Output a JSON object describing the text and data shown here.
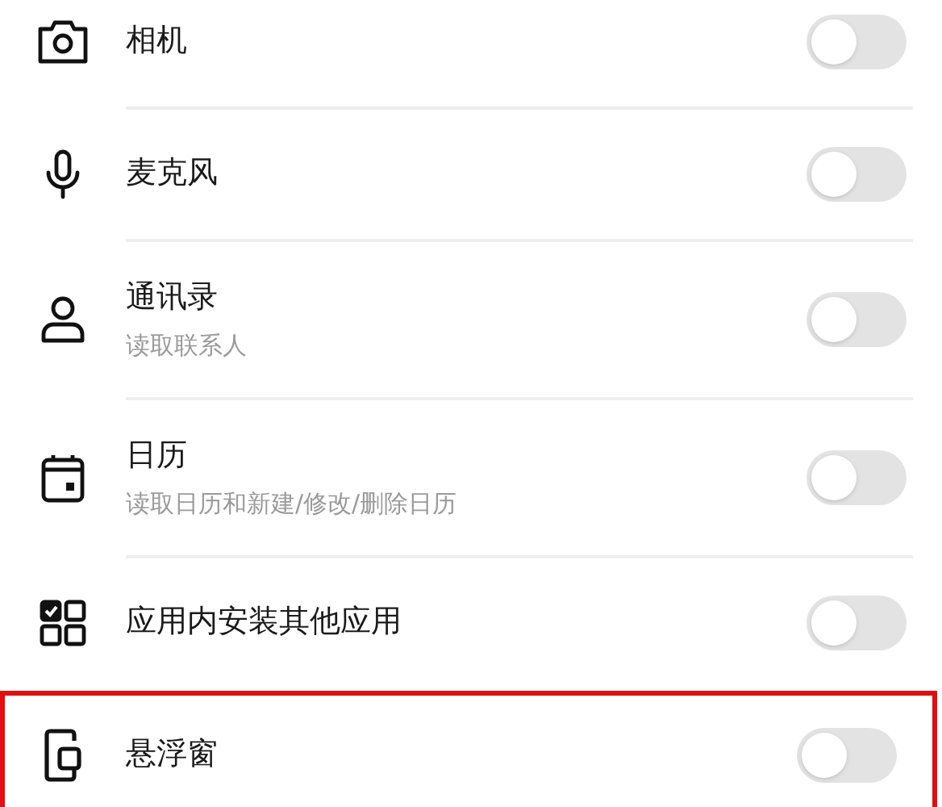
{
  "rows": [
    {
      "kind": "camera",
      "title": "相机",
      "on": false,
      "highlighted": false
    },
    {
      "kind": "microphone",
      "title": "麦克风",
      "on": false,
      "highlighted": false
    },
    {
      "kind": "contacts",
      "title": "通讯录",
      "subtitle": "读取联系人",
      "on": false,
      "highlighted": false
    },
    {
      "kind": "calendar",
      "title": "日历",
      "subtitle": "读取日历和新建/修改/删除日历",
      "on": false,
      "highlighted": false
    },
    {
      "kind": "apps",
      "title": "应用内安装其他应用",
      "on": false,
      "highlighted": false
    },
    {
      "kind": "floating",
      "title": "悬浮窗",
      "on": false,
      "highlighted": true
    }
  ]
}
